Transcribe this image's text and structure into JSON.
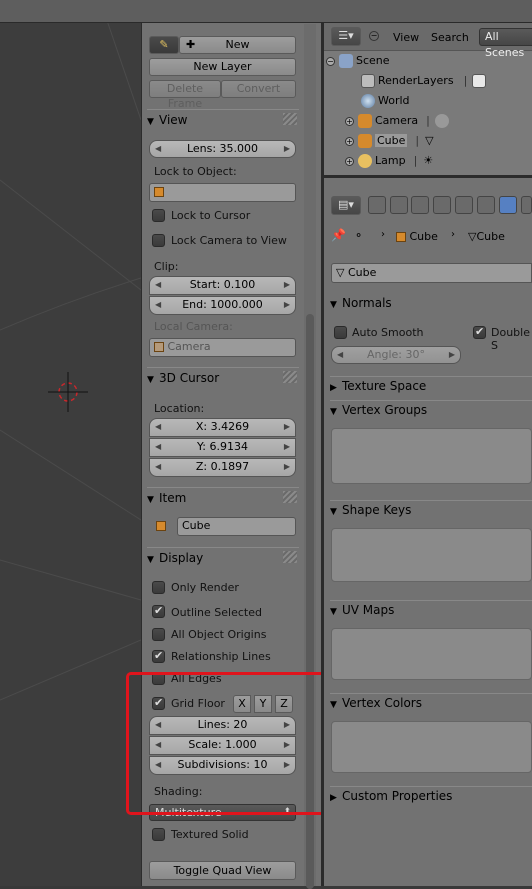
{
  "npanel": {
    "grease": {
      "new_label": "New",
      "new_layer_label": "New Layer",
      "delete_frame_label": "Delete Frame",
      "convert_label": "Convert"
    },
    "view": {
      "header": "View",
      "lens": "Lens: 35.000",
      "lock_to_object_label": "Lock to Object:",
      "lock_to_cursor_label": "Lock to Cursor",
      "lock_camera_label": "Lock Camera to View",
      "clip_label": "Clip:",
      "clip_start": "Start: 0.100",
      "clip_end": "End: 1000.000",
      "local_camera_label": "Local Camera:",
      "camera_value": "Camera"
    },
    "cursor": {
      "header": "3D Cursor",
      "location_label": "Location:",
      "x": "X: 3.4269",
      "y": "Y: 6.9134",
      "z": "Z: 0.1897"
    },
    "item": {
      "header": "Item",
      "name": "Cube"
    },
    "display": {
      "header": "Display",
      "only_render": "Only Render",
      "outline_selected": "Outline Selected",
      "all_object_origins": "All Object Origins",
      "relationship_lines": "Relationship Lines",
      "all_edges": "All Edges",
      "grid_floor": "Grid Floor",
      "axis_x": "X",
      "axis_y": "Y",
      "axis_z": "Z",
      "lines": "Lines: 20",
      "scale": "Scale: 1.000",
      "subdivisions": "Subdivisions: 10",
      "shading_label": "Shading:",
      "shading_value": "Multitexture",
      "textured_solid": "Textured Solid",
      "toggle_quad_view": "Toggle Quad View"
    }
  },
  "outliner": {
    "menu_view": "View",
    "menu_search": "Search",
    "scenes_dropdown": "All Scenes",
    "items": [
      {
        "label": "Scene"
      },
      {
        "label": "RenderLayers"
      },
      {
        "label": "World"
      },
      {
        "label": "Camera"
      },
      {
        "label": "Cube"
      },
      {
        "label": "Lamp"
      }
    ]
  },
  "properties": {
    "breadcrumb_object": "Cube",
    "breadcrumb_mesh": "Cube",
    "mesh_name": "Cube",
    "sections": {
      "normals": "Normals",
      "auto_smooth": "Auto Smooth",
      "double_sided": "Double S",
      "angle": "Angle: 30°",
      "texture_space": "Texture Space",
      "vertex_groups": "Vertex Groups",
      "shape_keys": "Shape Keys",
      "uv_maps": "UV Maps",
      "vertex_colors": "Vertex Colors",
      "custom_properties": "Custom Properties"
    }
  },
  "colors": {
    "highlight": "#e0141c",
    "object_orange": "#d68a2c"
  }
}
